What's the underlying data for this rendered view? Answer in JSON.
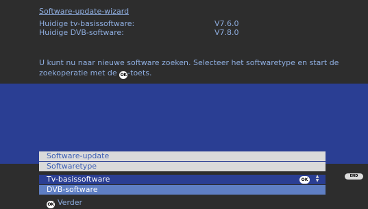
{
  "header": {
    "title": "Software-update-wizard",
    "tv_label": "Huidige tv-basissoftware:",
    "tv_version": "V7.6.0",
    "dvb_label": "Huidige DVB-software:",
    "dvb_version": "V7.8.0",
    "description_part1": "U kunt nu naar nieuwe software zoeken. Selecteer het softwaretype en start de zoekoperatie met de ",
    "description_part2": "-toets."
  },
  "menu": {
    "software_update": "Software-update",
    "software_type": "Softwaretype",
    "options": [
      "Tv-basissoftware",
      "DVB-software"
    ]
  },
  "buttons": {
    "ok": "OK",
    "end": "END",
    "next_label": "Verder"
  },
  "colors": {
    "background": "#2d2d2d",
    "blue_band": "#2a3e93",
    "text": "#8faee0",
    "highlight": "#5f7fc4"
  }
}
